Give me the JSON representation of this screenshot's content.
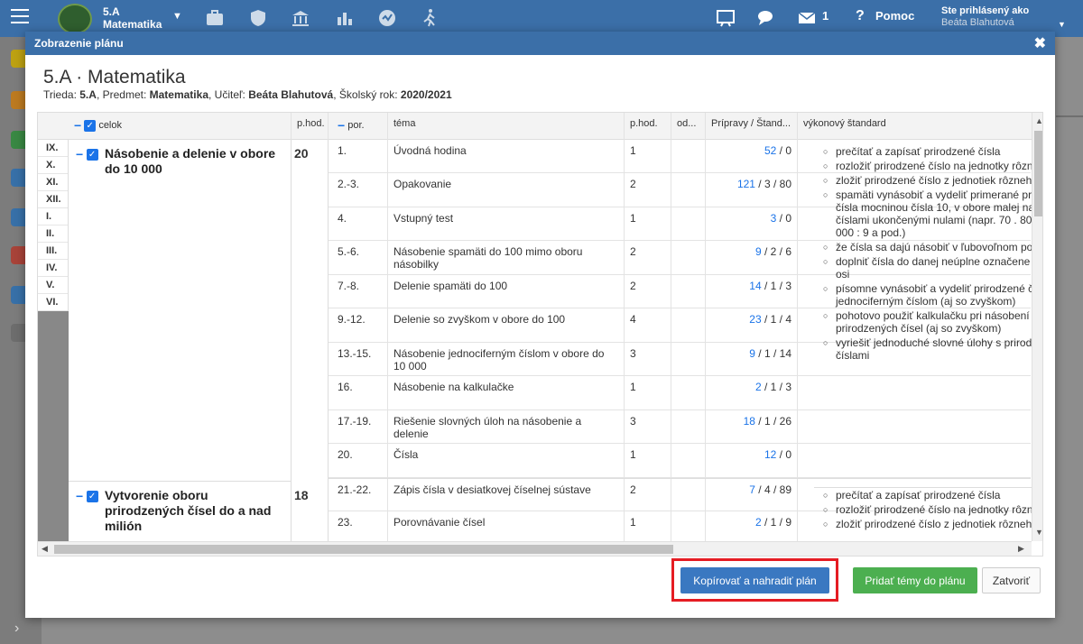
{
  "topbar": {
    "class_name": "5.A",
    "subject": "Matematika",
    "mail_count": "1",
    "help": "Pomoc",
    "logged_in_label": "Ste prihlásený ako",
    "user_name": "Beáta Blahutová"
  },
  "modal": {
    "title": "Zobrazenie plánu",
    "plan_title": "5.A · Matematika",
    "sub": {
      "trieda_label": "Trieda: ",
      "trieda": "5.A",
      "predmet_label": ", Predmet: ",
      "predmet": "Matematika",
      "ucitel_label": ", Učiteľ: ",
      "ucitel": "Beáta Blahutová",
      "rok_label": ", Školský rok: ",
      "rok": "2020/2021"
    }
  },
  "columns": {
    "celok": "celok",
    "phod": "p.hod.",
    "por": "por.",
    "tema": "téma",
    "phod2": "p.hod.",
    "od": "od...",
    "pripravy": "Prípravy / Štand...",
    "standard": "výkonový štandard"
  },
  "months": [
    "IX.",
    "X.",
    "XI.",
    "XII.",
    "I.",
    "II.",
    "III.",
    "IV.",
    "V.",
    "VI."
  ],
  "units": [
    {
      "name": "Násobenie a delenie v obore do 10 000",
      "hours": "20",
      "standards": [
        "prečítať a zapísať prirodzené čísla",
        "rozložiť prirodzené číslo na jednotky rôzn",
        "zložiť prirodzené číslo z jednotiek rôzneh",
        "spamäti vynásobiť a vydeliť primerané pr čísla mocninou čísla 10, v obore malej na číslami ukončenými nulami (napr. 70 . 80 000 : 9 a pod.)",
        "že čísla sa dajú násobiť v ľubovoľnom po",
        "doplniť čísla do danej neúplne označene osi",
        "písomne vynásobiť a vydeliť prirodzené č jednociferným číslom (aj so zvyškom)",
        "pohotovo použiť kalkulačku pri násobení prirodzených čísel (aj so zvyškom)",
        "vyriešiť jednoduché slovné úlohy s prirod číslami"
      ]
    },
    {
      "name": "Vytvorenie oboru prirodzených čísel do a nad milión",
      "hours": "18",
      "standards": [
        "prečítať a zapísať prirodzené čísla",
        "rozložiť prirodzené číslo na jednotky rôzn",
        "zložiť prirodzené číslo z jednotiek rôzneh"
      ]
    }
  ],
  "rows": [
    {
      "por": "1.",
      "tema": "Úvodná hodina",
      "hod": "1",
      "link": "52",
      "rest": " / 0"
    },
    {
      "por": "2.-3.",
      "tema": "Opakovanie",
      "hod": "2",
      "link": "121",
      "rest": " / 3 / 80"
    },
    {
      "por": "4.",
      "tema": "Vstupný test",
      "hod": "1",
      "link": "3",
      "rest": " / 0"
    },
    {
      "por": "5.-6.",
      "tema": "Násobenie spamäti do 100 mimo oboru násobilky",
      "hod": "2",
      "link": "9",
      "rest": " / 2 / 6"
    },
    {
      "por": "7.-8.",
      "tema": "Delenie spamäti do 100",
      "hod": "2",
      "link": "14",
      "rest": " / 1 / 3"
    },
    {
      "por": "9.-12.",
      "tema": "Delenie so zvyškom v obore do 100",
      "hod": "4",
      "link": "23",
      "rest": " / 1 / 4"
    },
    {
      "por": "13.-15.",
      "tema": "Násobenie jednociferným číslom v obore do 10 000",
      "hod": "3",
      "link": "9",
      "rest": " / 1 / 14"
    },
    {
      "por": "16.",
      "tema": "Násobenie na kalkulačke",
      "hod": "1",
      "link": "2",
      "rest": " / 1 / 3"
    },
    {
      "por": "17.-19.",
      "tema": "Riešenie slovných úloh na násobenie a delenie",
      "hod": "3",
      "link": "18",
      "rest": " / 1 / 26"
    },
    {
      "por": "20.",
      "tema": "Čísla",
      "hod": "1",
      "link": "12",
      "rest": " / 0"
    },
    {
      "por": "21.-22.",
      "tema": "Zápis čísla v desiatkovej číselnej sústave",
      "hod": "2",
      "link": "7",
      "rest": " / 4 / 89"
    },
    {
      "por": "23.",
      "tema": "Porovnávanie čísel",
      "hod": "1",
      "link": "2",
      "rest": " / 1 / 9"
    }
  ],
  "buttons": {
    "copy": "Kopírovať a nahradiť plán",
    "add": "Pridať témy do plánu",
    "close": "Zatvoriť"
  },
  "colors": {
    "topbar": "#3b6fa8",
    "link": "#1a73e8",
    "highlight": "#e51c23",
    "green": "#4caf50"
  }
}
